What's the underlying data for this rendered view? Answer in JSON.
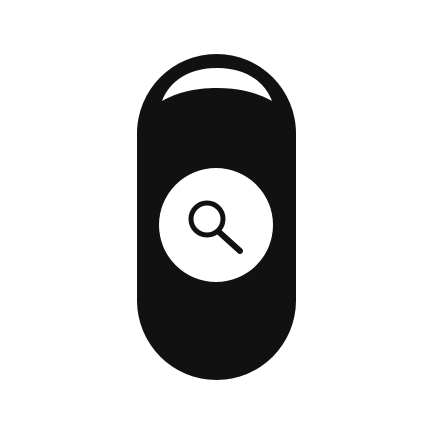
{
  "icon": {
    "name": "search-capsule-icon",
    "inner_icon": "magnifying-glass-icon"
  },
  "colors": {
    "background": "#ffffff",
    "capsule": "#111111",
    "highlight": "#ffffff",
    "lens_disc": "#ffffff",
    "glyph": "#111111"
  }
}
